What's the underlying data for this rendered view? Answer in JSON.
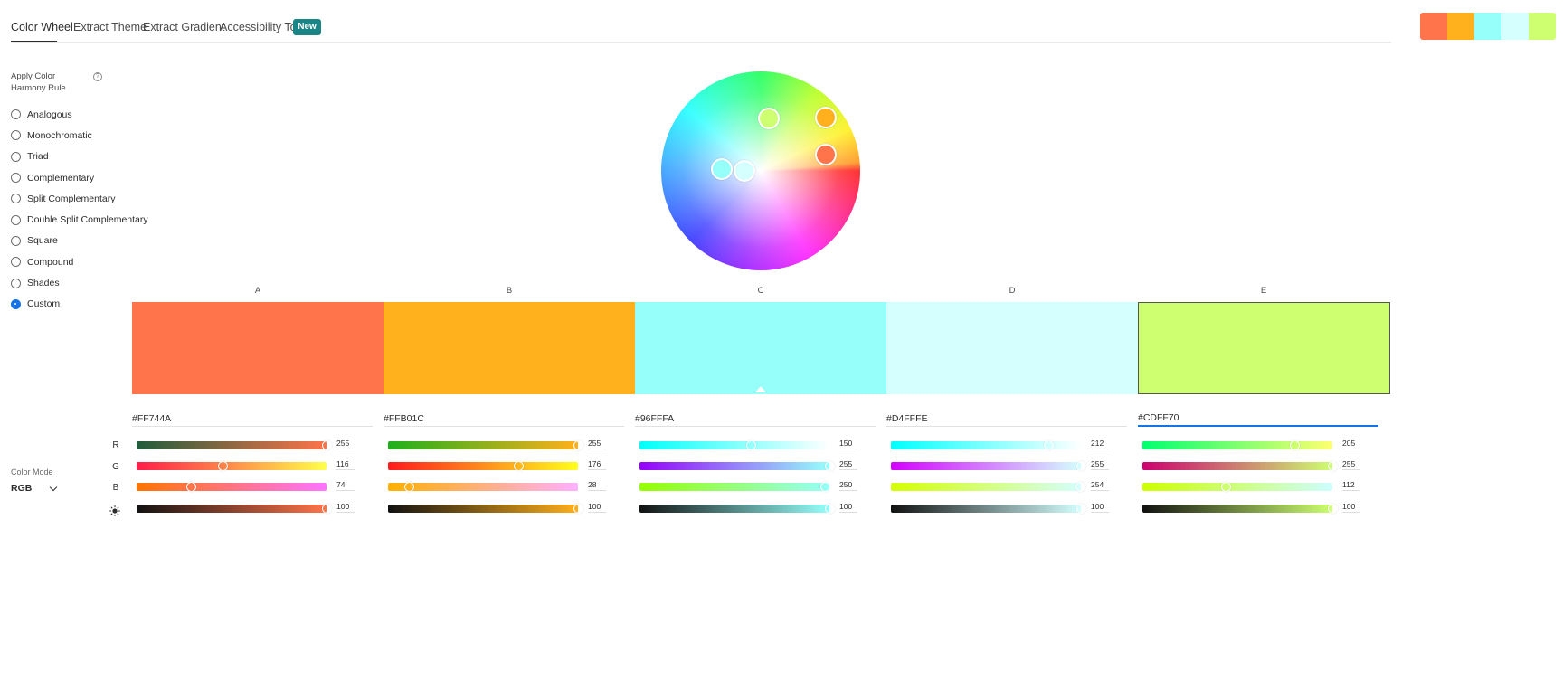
{
  "tabs": [
    {
      "label": "Color Wheel",
      "active": true
    },
    {
      "label": "Extract Theme",
      "active": false
    },
    {
      "label": "Extract Gradient",
      "active": false
    },
    {
      "label": "Accessibility Tools",
      "active": false
    }
  ],
  "new_badge": "New",
  "harmony": {
    "label": "Apply Color Harmony Rule",
    "help_icon": "question-circle-icon",
    "help_glyph": "?",
    "rules": [
      {
        "label": "Analogous",
        "checked": false
      },
      {
        "label": "Monochromatic",
        "checked": false
      },
      {
        "label": "Triad",
        "checked": false
      },
      {
        "label": "Complementary",
        "checked": false
      },
      {
        "label": "Split Complementary",
        "checked": false
      },
      {
        "label": "Double Split Complementary",
        "checked": false
      },
      {
        "label": "Square",
        "checked": false
      },
      {
        "label": "Compound",
        "checked": false
      },
      {
        "label": "Shades",
        "checked": false
      },
      {
        "label": "Custom",
        "checked": true
      }
    ]
  },
  "base_swatch": "C",
  "selected_swatch": "E",
  "swatches": [
    {
      "letter": "A",
      "hex": "#FF744A",
      "color": "#FF744A",
      "hue_deg": 14,
      "saturation": 0.71,
      "channels": {
        "R": 255,
        "G": 116,
        "B": 74,
        "brightness": 100
      },
      "gradients": [
        "#1f5c3c,#ff744a",
        "#ff1c4a,#ffff4a",
        "#ff7400,#ff74ff",
        "#111111,#ff744a"
      ]
    },
    {
      "letter": "B",
      "hex": "#FFB01C",
      "color": "#FFB01C",
      "hue_deg": 39,
      "saturation": 0.89,
      "channels": {
        "R": 255,
        "G": 176,
        "B": 28,
        "brightness": 100
      },
      "gradients": [
        "#1faf1c,#ffb01c",
        "#ff1a1c,#ffff1c",
        "#ffb000,#ffb0ff",
        "#111111,#ffb01c"
      ]
    },
    {
      "letter": "C",
      "hex": "#96FFFA",
      "color": "#96FFFA",
      "hue_deg": 177,
      "saturation": 0.41,
      "channels": {
        "R": 150,
        "G": 255,
        "B": 250,
        "brightness": 100
      },
      "gradients": [
        "#00fffa,#ffffff",
        "#9600fa,#96fffa",
        "#96ff00,#96fffa",
        "#111111,#96fffa"
      ]
    },
    {
      "letter": "D",
      "hex": "#D4FFFE",
      "color": "#D4FFFE",
      "hue_deg": 179,
      "saturation": 0.17,
      "channels": {
        "R": 212,
        "G": 255,
        "B": 254,
        "brightness": 100
      },
      "gradients": [
        "#00fffe,#ffffff",
        "#d400fe,#d4fffe",
        "#d4ff00,#d4fffe",
        "#111111,#d4fffe"
      ]
    },
    {
      "letter": "E",
      "hex": "#CDFF70",
      "color": "#CDFF70",
      "hue_deg": 81,
      "saturation": 0.56,
      "channels": {
        "R": 205,
        "G": 255,
        "B": 112,
        "brightness": 100
      },
      "gradients": [
        "#00ff70,#ffff70",
        "#cd0070,#cdff70",
        "#cdff00,#cdffff",
        "#111111,#cdff70"
      ]
    }
  ],
  "channel_labels": [
    "R",
    "G",
    "B"
  ],
  "brightness_icon": "brightness-sun-icon",
  "color_mode": {
    "label": "Color Mode",
    "value": "RGB"
  }
}
